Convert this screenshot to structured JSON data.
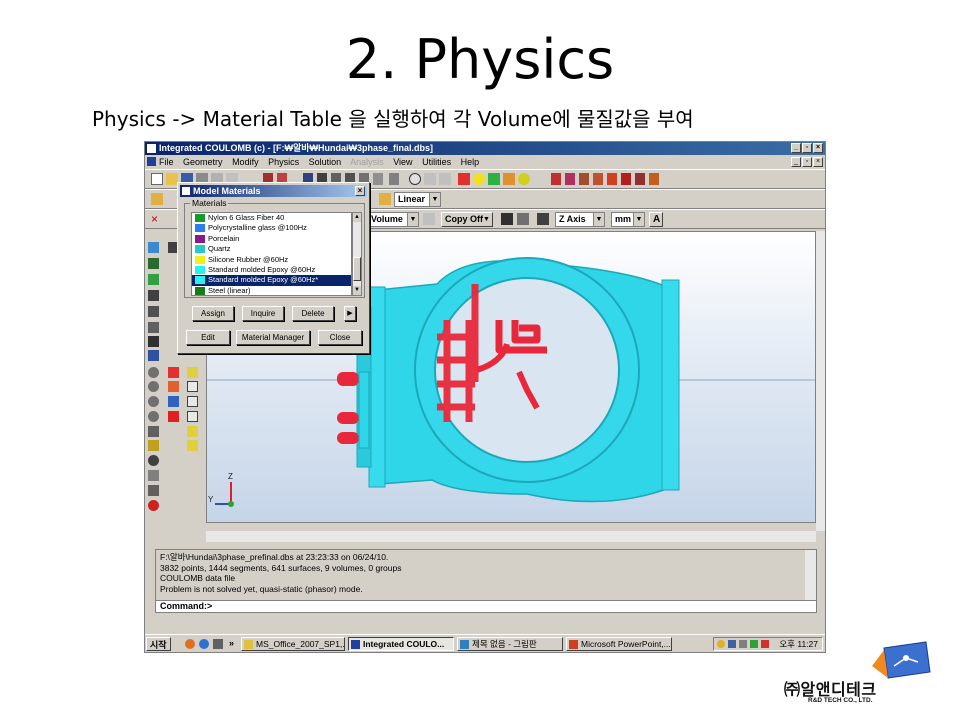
{
  "slide": {
    "title": "2. Physics",
    "subtitle": "Physics -> Material Table 을 실행하여 각 Volume에 물질값을 부여"
  },
  "app": {
    "title": "Integrated COULOMB (c) - [F:₩알바₩Hundai₩3phase_final.dbs]",
    "menu": [
      "File",
      "Geometry",
      "Modify",
      "Physics",
      "Solution",
      "Analysis",
      "View",
      "Utilities",
      "Help"
    ],
    "disabled_menu": "Analysis",
    "toolbar": {
      "mode": "Linear",
      "volume": "Volume",
      "copy": "Copy Off",
      "axis": "Z Axis",
      "units": "mm",
      "text_tool": "A"
    }
  },
  "dialog": {
    "title": "Model Materials",
    "group_label": "Materials",
    "materials": [
      {
        "name": "Nylon 6 Glass Fiber 40",
        "color": "#1a9a2a"
      },
      {
        "name": "Polycrystalline glass @100Hz",
        "color": "#2a7ef0"
      },
      {
        "name": "Porcelain",
        "color": "#8a1a8a"
      },
      {
        "name": "Quartz",
        "color": "#28c8c8"
      },
      {
        "name": "Silicone Rubber @60Hz",
        "color": "#f0f020"
      },
      {
        "name": "Standard molded Epoxy @60Hz",
        "color": "#2af0f0"
      },
      {
        "name": "Standard molded Epoxy @60Hz*",
        "color": "#2af0f0"
      },
      {
        "name": "Steel (linear)",
        "color": "#1a7a1a"
      }
    ],
    "selected_index": 6,
    "buttons": {
      "assign": "Assign",
      "inquire": "Inquire",
      "delete": "Delete",
      "more": "▶",
      "edit": "Edit",
      "manager": "Material Manager",
      "close": "Close"
    }
  },
  "console": {
    "lines": [
      "F:\\알바\\Hundai\\3phase_prefinal.dbs at 23:23:33 on 06/24/10.",
      "3832 points,    1444 segments,    641 surfaces,    9 volumes,    0 groups",
      "COULOMB data file",
      "Problem is not solved yet, quasi-static (phasor) mode."
    ],
    "prompt": "Command:>"
  },
  "taskbar": {
    "start": "시작",
    "chevron": "»",
    "tasks": [
      {
        "label": "MS_Office_2007_SP1,...",
        "active": false
      },
      {
        "label": "Integrated COULO...",
        "active": true
      },
      {
        "label": "제목 없음 - 그림판",
        "active": false
      },
      {
        "label": "Microsoft PowerPoint,...",
        "active": false
      }
    ],
    "clock": "오후 11:27"
  },
  "axes": {
    "z": "Z",
    "y": "Y"
  },
  "logo": {
    "korean": "㈜알앤디테크",
    "english": "R&D TECH CO., LTD."
  },
  "colors": {
    "housing": "#2fd6e8",
    "conductor": "#e8283a",
    "titlebar": "#0a246a",
    "selection": "#0a246a"
  }
}
